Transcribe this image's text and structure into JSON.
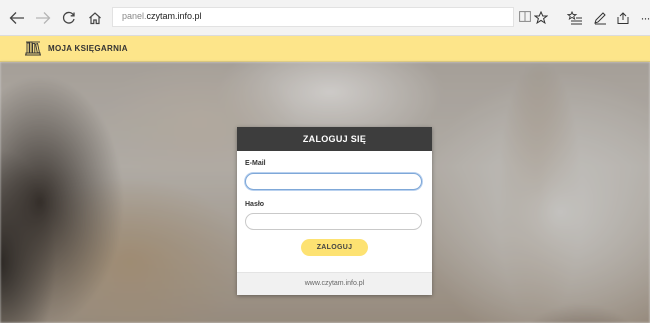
{
  "browser": {
    "url_subdomain": "panel.",
    "url_domain": "czytam.info.pl",
    "icons": {
      "back": "back-arrow-icon",
      "forward": "forward-arrow-icon",
      "refresh": "refresh-icon",
      "home": "home-icon",
      "reading_view": "reading-view-icon",
      "favorite": "star-icon",
      "favorites_hub": "favorites-list-icon",
      "notes": "pen-icon",
      "share": "share-icon",
      "more": "more-icon"
    },
    "more_glyph": "···"
  },
  "site": {
    "name": "MOJA KSIĘGARNIA",
    "logo_icon": "bookshelf-icon",
    "header_color": "#fde58a"
  },
  "login": {
    "title": "ZALOGUJ SIĘ",
    "email_label": "E-Mail",
    "email_value": "",
    "email_placeholder": "",
    "password_label": "Hasło",
    "password_value": "",
    "password_placeholder": "",
    "submit_label": "ZALOGUJ",
    "footer_link": "www.czytam.info.pl",
    "header_color": "#3d3d3d",
    "button_color": "#fde272"
  }
}
